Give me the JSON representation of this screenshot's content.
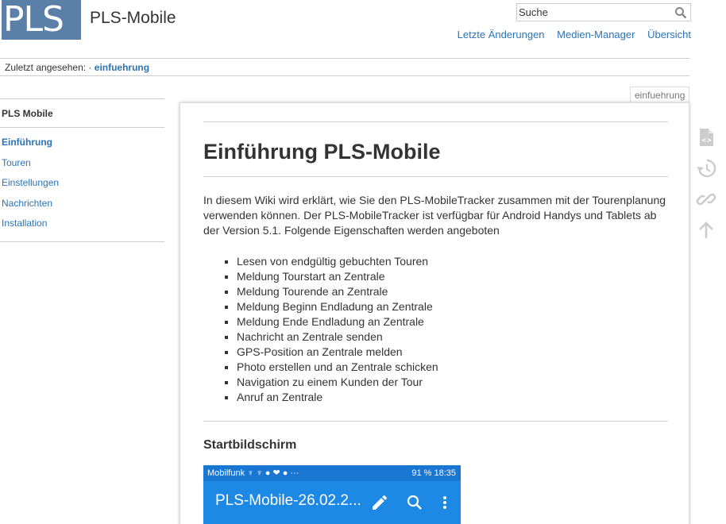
{
  "header": {
    "logo_text": "PLS",
    "site_title": "PLS-Mobile",
    "search_placeholder": "Suche",
    "nav": [
      "Letzte Änderungen",
      "Medien-Manager",
      "Übersicht"
    ]
  },
  "breadcrumbs": {
    "label": "Zuletzt angesehen:",
    "separator": "·",
    "link": "einfuehrung"
  },
  "sidebar": {
    "title": "PLS Mobile",
    "items": [
      {
        "label": "Einführung",
        "active": true
      },
      {
        "label": "Touren"
      },
      {
        "label": "Einstellungen"
      },
      {
        "label": "Nachrichten"
      },
      {
        "label": "Installation"
      }
    ]
  },
  "page": {
    "tab_label": "einfuehrung",
    "title": "Einführung PLS-Mobile",
    "intro": "In diesem Wiki wird erklärt, wie Sie den PLS-MobileTracker zusammen mit der Tourenplanung verwenden können. Der PLS-MobileTracker ist verfügbar für Android Handys und Tablets ab der Version 5.1. Folgende Eigenschaften werden angeboten",
    "features": [
      "Lesen von endgültig gebuchten Touren",
      "Meldung Tourstart an Zentrale",
      "Meldung Tourende an Zentrale",
      "Meldung Beginn Endladung an Zentrale",
      "Meldung Ende Endladung an Zentrale",
      "Nachricht an Zentrale senden",
      "GPS-Position an Zentrale melden",
      "Photo erstellen und an Zentrale schicken",
      "Navigation zu einem Kunden der Tour",
      "Anruf an Zentrale"
    ],
    "section_title": "Startbildschirm"
  },
  "phone_screenshot": {
    "status_left": "Mobilfunk ♆ ♆ ● ❤ ● ···",
    "status_right": "91 %  18:35",
    "app_title": "PLS-Mobile-26.02.2..."
  },
  "tools": [
    "source-icon",
    "history-icon",
    "backlinks-icon",
    "back-to-top-icon"
  ],
  "colors": {
    "link": "#2b73b7",
    "logo_bg": "#5a7fa8",
    "phone_bar": "#1e88e5"
  }
}
